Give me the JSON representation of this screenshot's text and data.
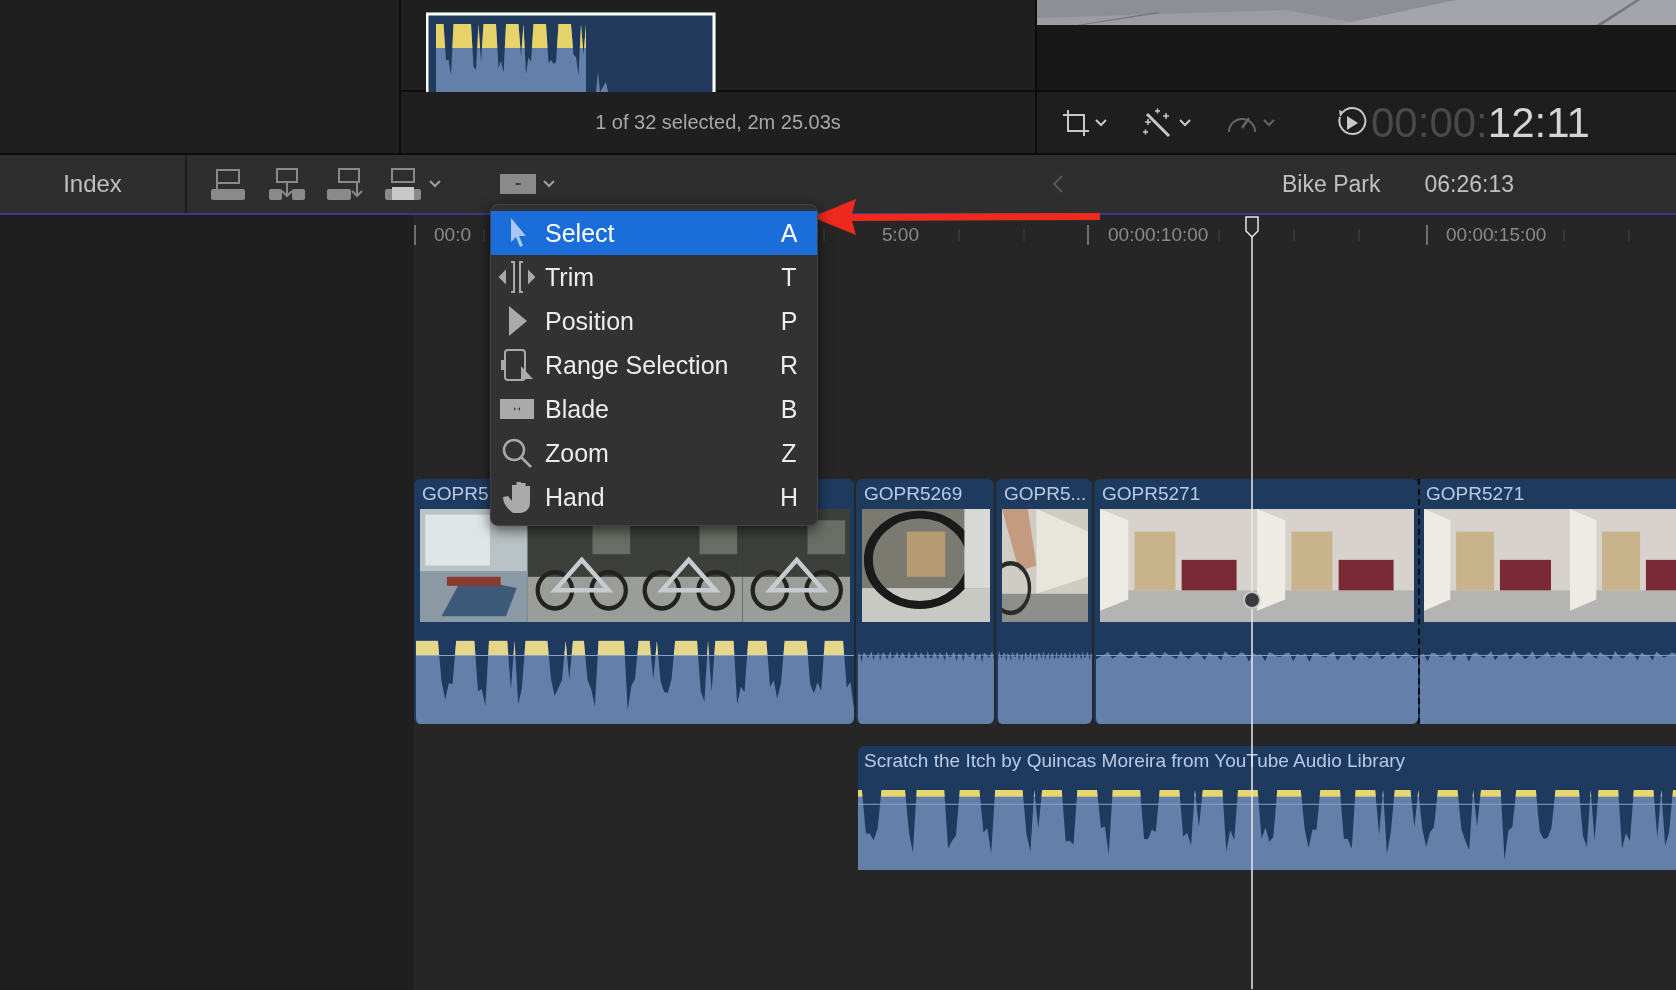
{
  "browser": {
    "status": "1 of 32 selected, 2m 25.03s"
  },
  "viewer_tools": [
    {
      "kind": "crop",
      "disabled": false
    },
    {
      "kind": "enhance",
      "disabled": false
    },
    {
      "kind": "speed",
      "disabled": true
    }
  ],
  "timecode": {
    "dim_part": "00:00:",
    "lit_part": "12:11"
  },
  "toolbar": {
    "index_button": "Index",
    "project_name": "Bike Park",
    "duration": "06:26:13"
  },
  "edit_tools": [
    {
      "kind": "connect"
    },
    {
      "kind": "insert"
    },
    {
      "kind": "append"
    },
    {
      "kind": "overwrite"
    }
  ],
  "ruler": {
    "labels": [
      "00:0",
      "5:00",
      "00:00:10:00",
      "00:00:15:00"
    ]
  },
  "tool_menu": {
    "items": [
      {
        "kind": "select",
        "label": "Select",
        "shortcut": "A",
        "selected": true
      },
      {
        "kind": "trim",
        "label": "Trim",
        "shortcut": "T",
        "selected": false
      },
      {
        "kind": "position",
        "label": "Position",
        "shortcut": "P",
        "selected": false
      },
      {
        "kind": "range",
        "label": "Range Selection",
        "shortcut": "R",
        "selected": false
      },
      {
        "kind": "blade",
        "label": "Blade",
        "shortcut": "B",
        "selected": false
      },
      {
        "kind": "zoom",
        "label": "Zoom",
        "shortcut": "Z",
        "selected": false
      },
      {
        "kind": "hand",
        "label": "Hand",
        "shortcut": "H",
        "selected": false
      }
    ]
  },
  "clips": [
    {
      "name": "GOPR5",
      "through_edit": false
    },
    {
      "name": "GOPR5269",
      "through_edit": false
    },
    {
      "name": "GOPR5...",
      "through_edit": false
    },
    {
      "name": "GOPR5271",
      "through_edit": false
    },
    {
      "name": "GOPR5271",
      "through_edit": true
    }
  ],
  "audio_clip": {
    "name": "Scratch the Itch by Quincas Moreira from YouTube Audio Library"
  }
}
